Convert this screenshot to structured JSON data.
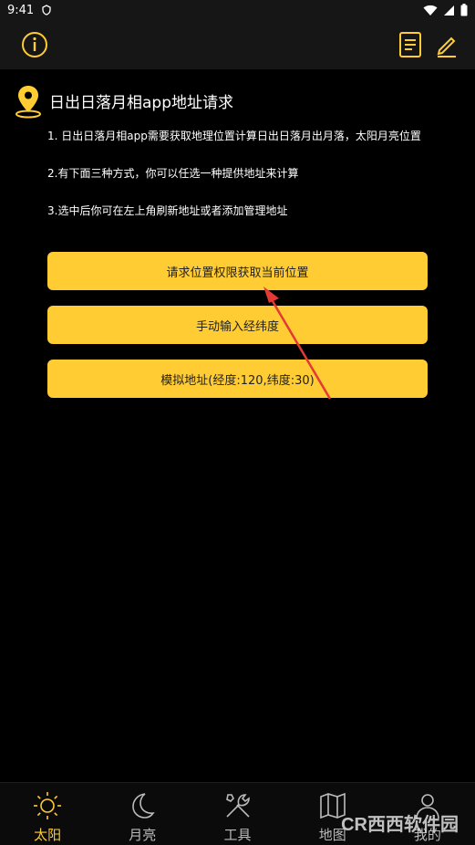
{
  "status_bar": {
    "time": "9:41"
  },
  "header": {
    "title": "日出日落月相app地址请求"
  },
  "descriptions": [
    "1. 日出日落月相app需要获取地理位置计算日出日落月出月落，太阳月亮位置",
    "2.有下面三种方式，你可以任选一种提供地址来计算",
    "3.选中后你可在左上角刷新地址或者添加管理地址"
  ],
  "buttons": {
    "request_permission": "请求位置权限获取当前位置",
    "manual_input": "手动输入经纬度",
    "simulate_address": "模拟地址(经度:120,纬度:30)"
  },
  "bottom_nav": [
    {
      "label": "太阳",
      "icon": "sun-icon",
      "active": true
    },
    {
      "label": "月亮",
      "icon": "moon-icon",
      "active": false
    },
    {
      "label": "工具",
      "icon": "tools-icon",
      "active": false
    },
    {
      "label": "地图",
      "icon": "map-icon",
      "active": false
    },
    {
      "label": "我的",
      "icon": "person-icon",
      "active": false
    }
  ],
  "watermark": "CR西西软件园",
  "colors": {
    "accent": "#FFCC33",
    "background": "#000000",
    "bar": "#161616",
    "arrow": "#E53935"
  }
}
